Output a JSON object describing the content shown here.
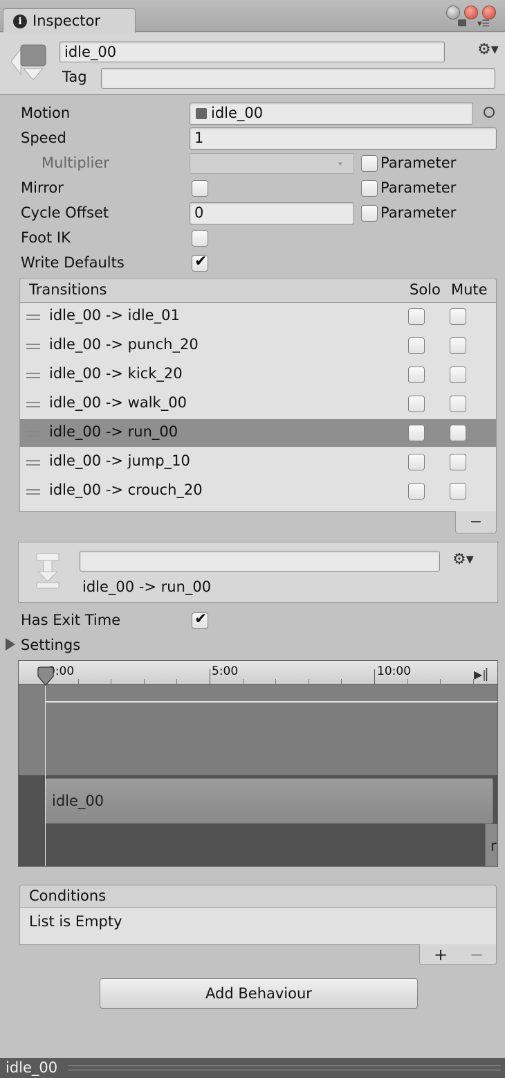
{
  "window": {
    "tab_label": "Inspector"
  },
  "header": {
    "name_value": "idle_00",
    "tag_label": "Tag",
    "tag_value": ""
  },
  "props": {
    "motion_label": "Motion",
    "motion_value": "idle_00",
    "speed_label": "Speed",
    "speed_value": "1",
    "multiplier_label": "Multiplier",
    "mirror_label": "Mirror",
    "cycle_offset_label": "Cycle Offset",
    "cycle_offset_value": "0",
    "foot_ik_label": "Foot IK",
    "write_defaults_label": "Write Defaults",
    "parameter_label": "Parameter",
    "mirror_checked": false,
    "foot_ik_checked": false,
    "write_defaults_checked": true
  },
  "transitions": {
    "header": "Transitions",
    "solo_label": "Solo",
    "mute_label": "Mute",
    "rows": [
      "idle_00 -> idle_01",
      "idle_00 -> punch_20",
      "idle_00 -> kick_20",
      "idle_00 -> walk_00",
      "idle_00 -> run_00",
      "idle_00 -> jump_10",
      "idle_00 -> crouch_20"
    ],
    "selected": "idle_00 -> run_00",
    "remove_label": "−"
  },
  "transition_detail": {
    "name_value": "",
    "title": "idle_00 -> run_00",
    "has_exit_time_label": "Has Exit Time",
    "has_exit_time_checked": true,
    "settings_label": "Settings"
  },
  "timeline": {
    "ticks": [
      "0:00",
      "5:00",
      "10:00"
    ],
    "clip_label": "idle_00",
    "next_clip_label": "r"
  },
  "conditions": {
    "header": "Conditions",
    "empty_text": "List is Empty",
    "add_label": "+",
    "remove_label": "−"
  },
  "add_behaviour_label": "Add Behaviour",
  "footer": {
    "title": "idle_00"
  },
  "colors": {
    "selection": "#8f8f8f",
    "close": "#e05a4f",
    "panel": "#c2c2c2"
  }
}
